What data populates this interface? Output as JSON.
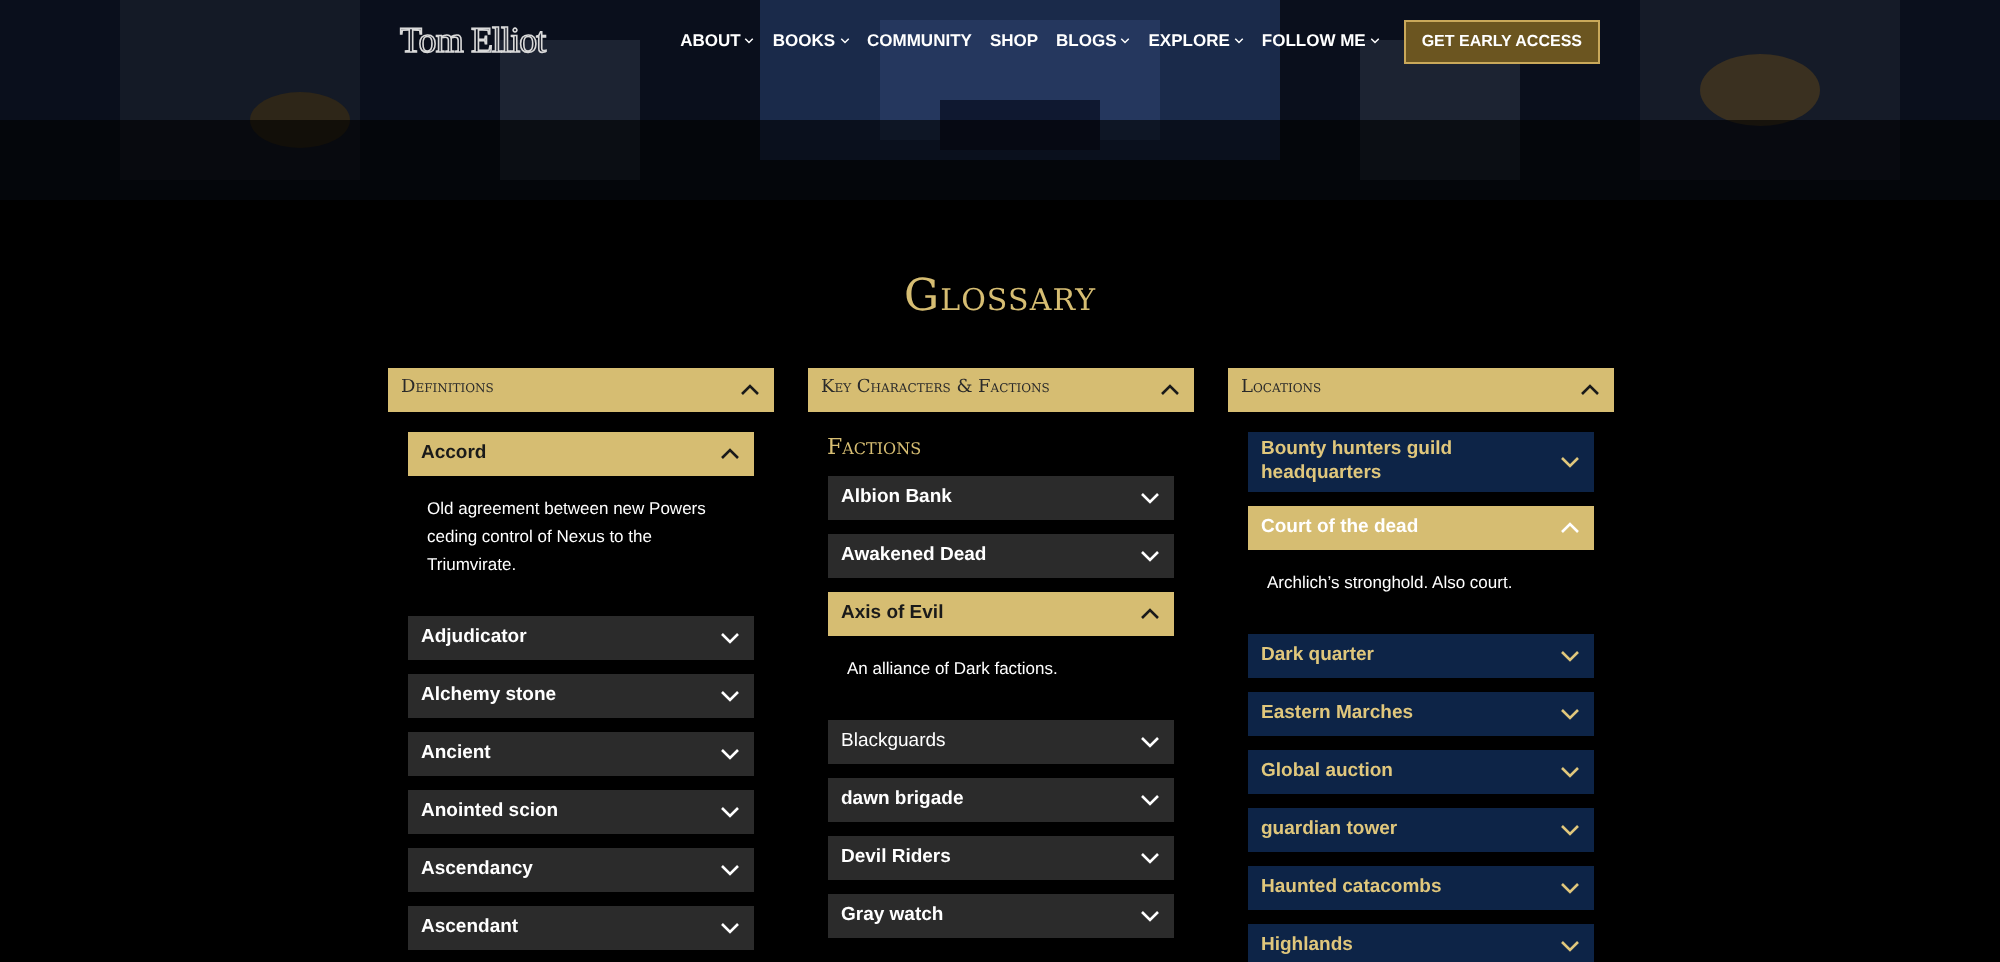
{
  "header": {
    "logo": "Tom Elliot",
    "nav": [
      {
        "label": "ABOUT",
        "has_menu": true
      },
      {
        "label": "BOOKS",
        "has_menu": true
      },
      {
        "label": "COMMUNITY",
        "has_menu": false
      },
      {
        "label": "SHOP",
        "has_menu": false
      },
      {
        "label": "BLOGS",
        "has_menu": true
      },
      {
        "label": "EXPLORE",
        "has_menu": true
      },
      {
        "label": "FOLLOW ME",
        "has_menu": true
      }
    ],
    "cta": "GET EARLY ACCESS"
  },
  "title": "Glossary",
  "panels": [
    {
      "title": "Definitions",
      "kind": "dark",
      "expanded": true,
      "items": [
        {
          "label": "Accord",
          "expanded": true,
          "description": "Old agreement between new Powers ceding control of Nexus to the Triumvirate."
        },
        {
          "label": "Adjudicator",
          "expanded": false
        },
        {
          "label": "Alchemy stone",
          "expanded": false
        },
        {
          "label": "Ancient",
          "expanded": false
        },
        {
          "label": "Anointed scion",
          "expanded": false
        },
        {
          "label": "Ascendancy",
          "expanded": false
        },
        {
          "label": "Ascendant",
          "expanded": false
        }
      ]
    },
    {
      "title": "Key Characters & Factions",
      "kind": "dark",
      "expanded": true,
      "subheading": "Factions",
      "items": [
        {
          "label": "Albion Bank",
          "expanded": false,
          "bold": true
        },
        {
          "label": "Awakened Dead",
          "expanded": false,
          "bold": true
        },
        {
          "label": "Axis of Evil",
          "expanded": true,
          "bold": true,
          "description": "An alliance of Dark factions."
        },
        {
          "label": "Blackguards",
          "expanded": false,
          "bold": false
        },
        {
          "label": "dawn brigade",
          "expanded": false,
          "bold": true
        },
        {
          "label": "Devil Riders",
          "expanded": false,
          "bold": true
        },
        {
          "label": "Gray watch",
          "expanded": false,
          "bold": true
        }
      ]
    },
    {
      "title": "Locations",
      "kind": "navy",
      "expanded": true,
      "items": [
        {
          "label": "Bounty hunters guild headquarters",
          "expanded": false
        },
        {
          "label": "Court of the dead",
          "expanded": true,
          "description": "Archlich’s stronghold. Also court."
        },
        {
          "label": "Dark quarter",
          "expanded": false
        },
        {
          "label": "Eastern Marches",
          "expanded": false
        },
        {
          "label": "Global auction",
          "expanded": false
        },
        {
          "label": "guardian tower",
          "expanded": false
        },
        {
          "label": "Haunted catacombs",
          "expanded": false
        },
        {
          "label": "Highlands",
          "expanded": false
        }
      ]
    }
  ]
}
